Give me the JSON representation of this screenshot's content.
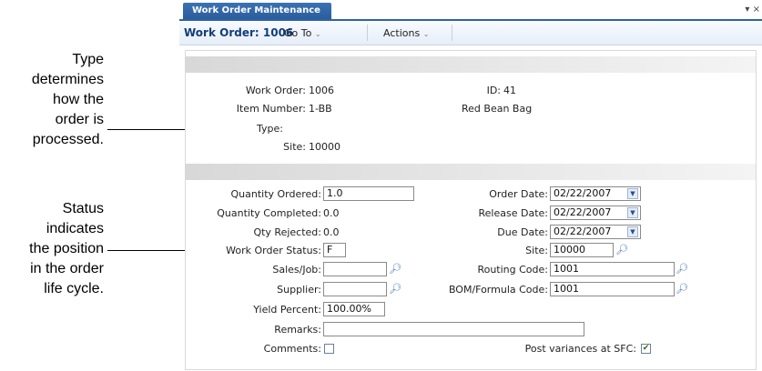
{
  "annotations": {
    "type_note": [
      "Type",
      "determines",
      "how the",
      "order is",
      "processed."
    ],
    "status_note": [
      "Status",
      "indicates",
      "the position",
      "in the order",
      "life cycle."
    ]
  },
  "window": {
    "tab_title": "Work Order Maintenance",
    "controls": "▾ ×"
  },
  "menubar": {
    "title": "Work Order: 1006",
    "goto_label": "Go To",
    "actions_label": "Actions"
  },
  "header": {
    "work_order_label": "Work Order:",
    "work_order_value": "1006",
    "id_label": "ID:",
    "id_value": "41",
    "item_label": "Item Number:",
    "item_value": "1-BB",
    "item_desc": "Red Bean Bag",
    "type_label": "Type:",
    "type_value": "",
    "site_label": "Site:",
    "site_value": "10000"
  },
  "details": {
    "qty_ordered_label": "Quantity Ordered:",
    "qty_ordered_value": "1.0",
    "qty_completed_label": "Quantity Completed:",
    "qty_completed_value": "0.0",
    "qty_rejected_label": "Qty Rejected:",
    "qty_rejected_value": "0.0",
    "status_label": "Work Order Status:",
    "status_value": "F",
    "sales_job_label": "Sales/Job:",
    "sales_job_value": "",
    "supplier_label": "Supplier:",
    "supplier_value": "",
    "yield_label": "Yield Percent:",
    "yield_value": "100.00%",
    "remarks_label": "Remarks:",
    "remarks_value": "",
    "comments_label": "Comments:",
    "comments_checked": false,
    "order_date_label": "Order Date:",
    "order_date_value": "02/22/2007",
    "release_date_label": "Release Date:",
    "release_date_value": "02/22/2007",
    "due_date_label": "Due Date:",
    "due_date_value": "02/22/2007",
    "site_label": "Site:",
    "site_value": "10000",
    "routing_label": "Routing Code:",
    "routing_value": "1001",
    "bom_label": "BOM/Formula Code:",
    "bom_value": "1001",
    "post_var_label": "Post variances at SFC:",
    "post_var_checked": true
  }
}
